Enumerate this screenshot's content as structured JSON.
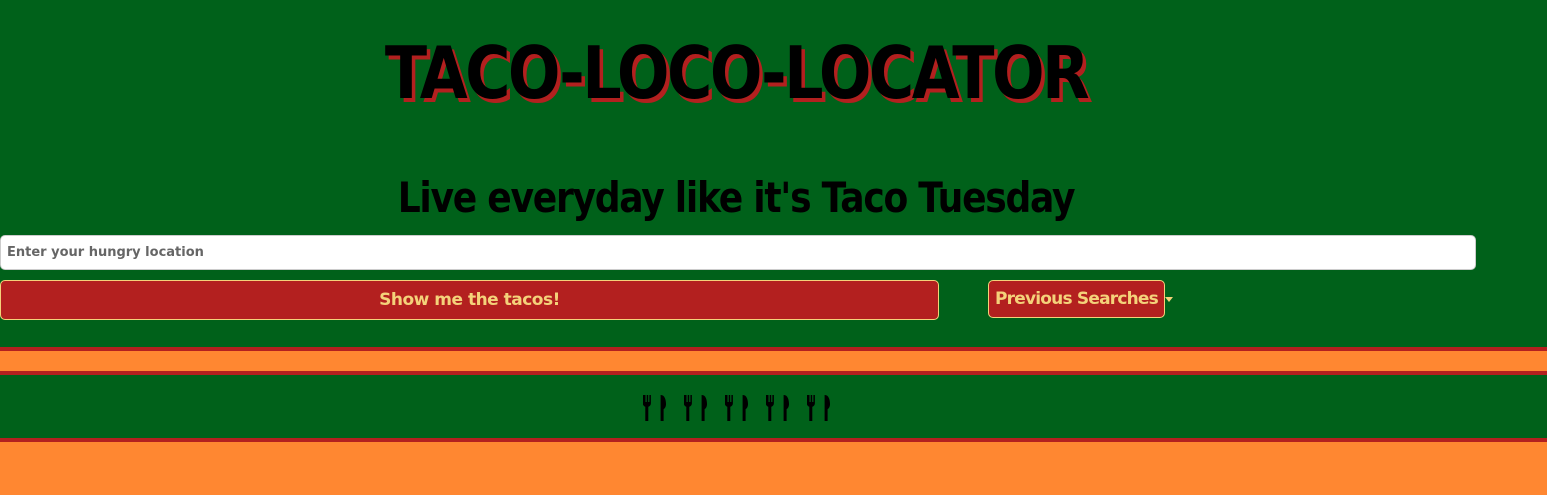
{
  "header": {
    "title": "TACO-LOCO-LOCATOR",
    "subtitle": "Live everyday like it's Taco Tuesday"
  },
  "search": {
    "placeholder": "Enter your hungry location",
    "value": ""
  },
  "actions": {
    "submit_label": "Show me the tacos!",
    "previous_searches_label": "Previous Searches"
  },
  "footer": {
    "icons": [
      "utensils-icon",
      "utensils-icon",
      "utensils-icon",
      "utensils-icon",
      "utensils-icon"
    ]
  },
  "colors": {
    "background": "#00611a",
    "accent_red": "#b3201f",
    "accent_orange": "#ff8731",
    "button_text": "#f4d27a"
  }
}
